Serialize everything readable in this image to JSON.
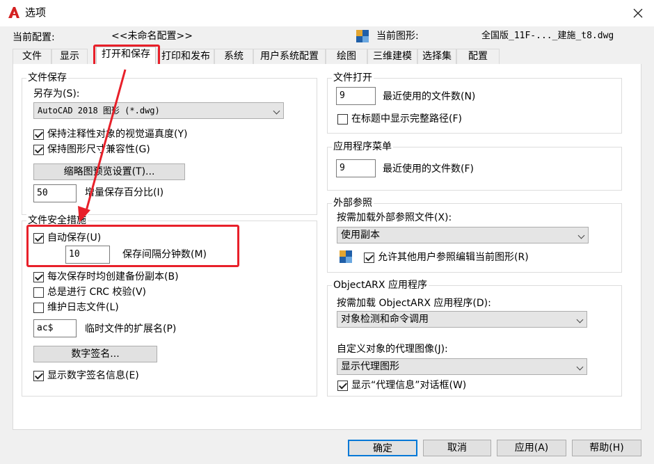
{
  "window": {
    "title": "选项",
    "close_label": "✕"
  },
  "header": {
    "profile_label": "当前配置:",
    "profile_value": "<<未命名配置>>",
    "drawing_label": "当前图形:",
    "drawing_value": "全国版_11F-..._建施_t8.dwg"
  },
  "tabs": [
    "文件",
    "显示",
    "打开和保存",
    "打印和发布",
    "系统",
    "用户系统配置",
    "绘图",
    "三维建模",
    "选择集",
    "配置"
  ],
  "active_tab": "打开和保存",
  "file_save": {
    "title": "文件保存",
    "save_as_label": "另存为(S):",
    "save_as_value": "AutoCAD 2018 图形 (*.dwg)",
    "keep_annotative_label": "保持注释性对象的视觉逼真度(Y)",
    "keep_annotative_checked": true,
    "keep_size_label": "保持图形尺寸兼容性(G)",
    "keep_size_checked": true,
    "thumbnail_button": "缩略图预览设置(T)...",
    "incremental_value": "50",
    "incremental_label": "增量保存百分比(I)"
  },
  "safety": {
    "title": "文件安全措施",
    "autosave_label": "自动保存(U)",
    "autosave_checked": true,
    "interval_value": "10",
    "interval_label": "保存间隔分钟数(M)",
    "backup_label": "每次保存时均创建备份副本(B)",
    "backup_checked": true,
    "crc_label": "总是进行 CRC 校验(V)",
    "crc_checked": false,
    "log_label": "维护日志文件(L)",
    "log_checked": false,
    "ext_value": "ac$",
    "ext_label": "临时文件的扩展名(P)",
    "signature_button": "数字签名...",
    "show_sig_label": "显示数字签名信息(E)",
    "show_sig_checked": true
  },
  "file_open": {
    "title": "文件打开",
    "recent_value": "9",
    "recent_label": "最近使用的文件数(N)",
    "fullpath_label": "在标题中显示完整路径(F)",
    "fullpath_checked": false
  },
  "app_menu": {
    "title": "应用程序菜单",
    "recent_value": "9",
    "recent_label": "最近使用的文件数(F)"
  },
  "xref": {
    "title": "外部参照",
    "demand_label": "按需加载外部参照文件(X):",
    "demand_value": "使用副本",
    "allow_label": "允许其他用户参照编辑当前图形(R)",
    "allow_checked": true
  },
  "objectarx": {
    "title": "ObjectARX 应用程序",
    "demand_label": "按需加载 ObjectARX 应用程序(D):",
    "demand_value": "对象检测和命令调用",
    "proxy_label": "自定义对象的代理图像(J):",
    "proxy_value": "显示代理图形",
    "proxy_info_label": "显示“代理信息”对话框(W)",
    "proxy_info_checked": true
  },
  "buttons": {
    "ok": "确定",
    "cancel": "取消",
    "apply": "应用(A)",
    "help": "帮助(H)"
  },
  "colors": {
    "accent": "#0078d7",
    "highlight": "#e8202a",
    "app_icon": "#d42121"
  }
}
